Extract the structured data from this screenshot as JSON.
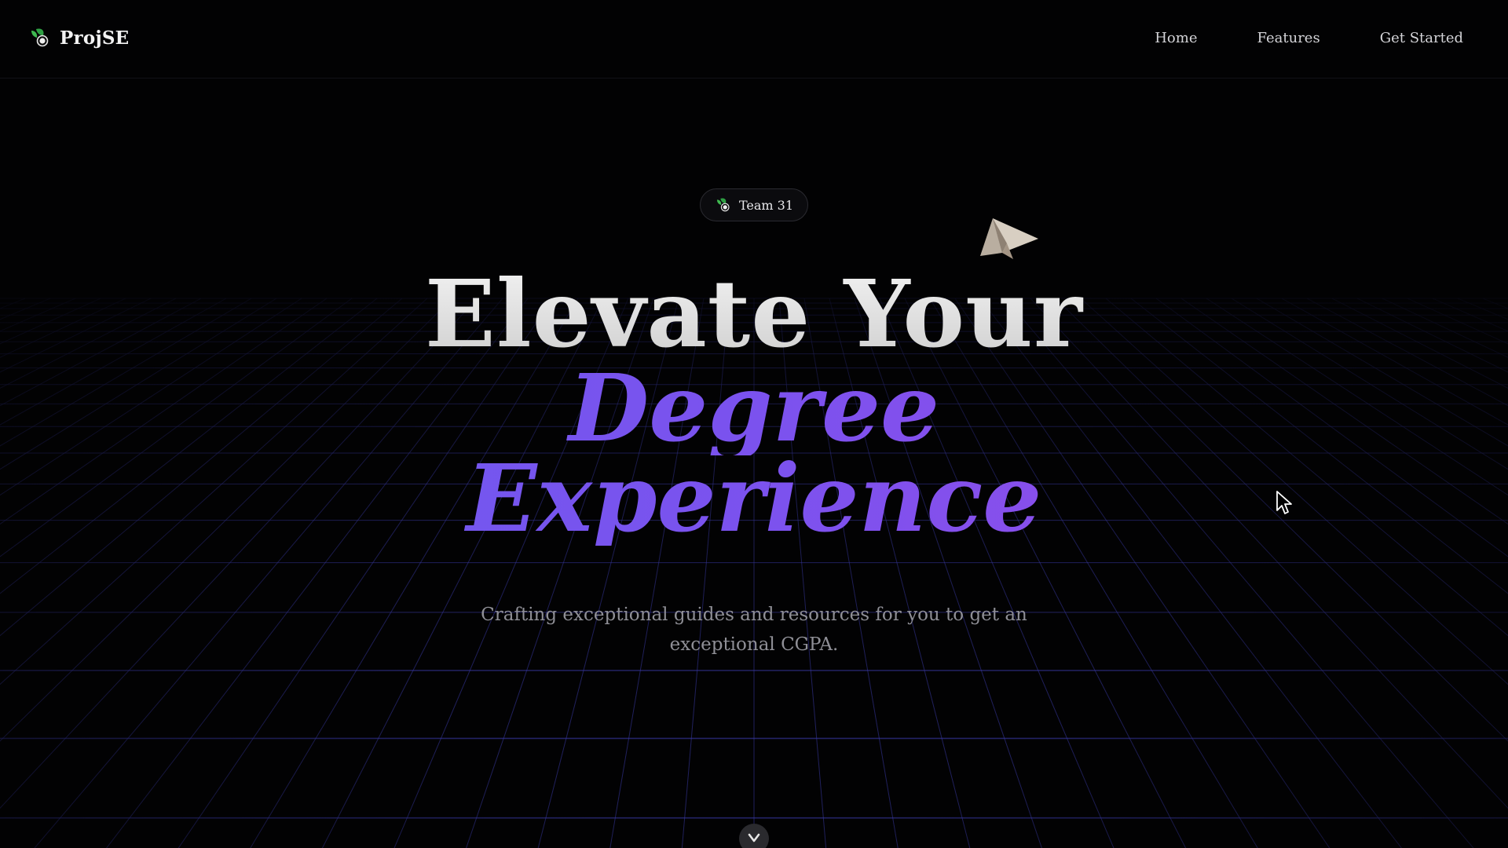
{
  "brand": {
    "name": "ProjSE",
    "logo_icon": "leaf-logo-icon"
  },
  "nav": {
    "items": [
      {
        "label": "Home"
      },
      {
        "label": "Features"
      },
      {
        "label": "Get Started"
      }
    ]
  },
  "hero": {
    "badge": {
      "label": "Team 31",
      "icon": "leaf-logo-icon"
    },
    "title_line1": "Elevate Your",
    "title_line2": "Degree",
    "title_line3": "Experience",
    "subtitle": "Crafting exceptional guides and resources for you to get an exceptional CGPA.",
    "decoration_icon": "paper-plane-icon",
    "scroll_icon": "chevron-down-icon"
  },
  "colors": {
    "background": "#020203",
    "accent_start": "#6a5cf0",
    "accent_end": "#9b4ae8",
    "grid_line": "#3b3aa8",
    "logo_green": "#3fb950"
  }
}
